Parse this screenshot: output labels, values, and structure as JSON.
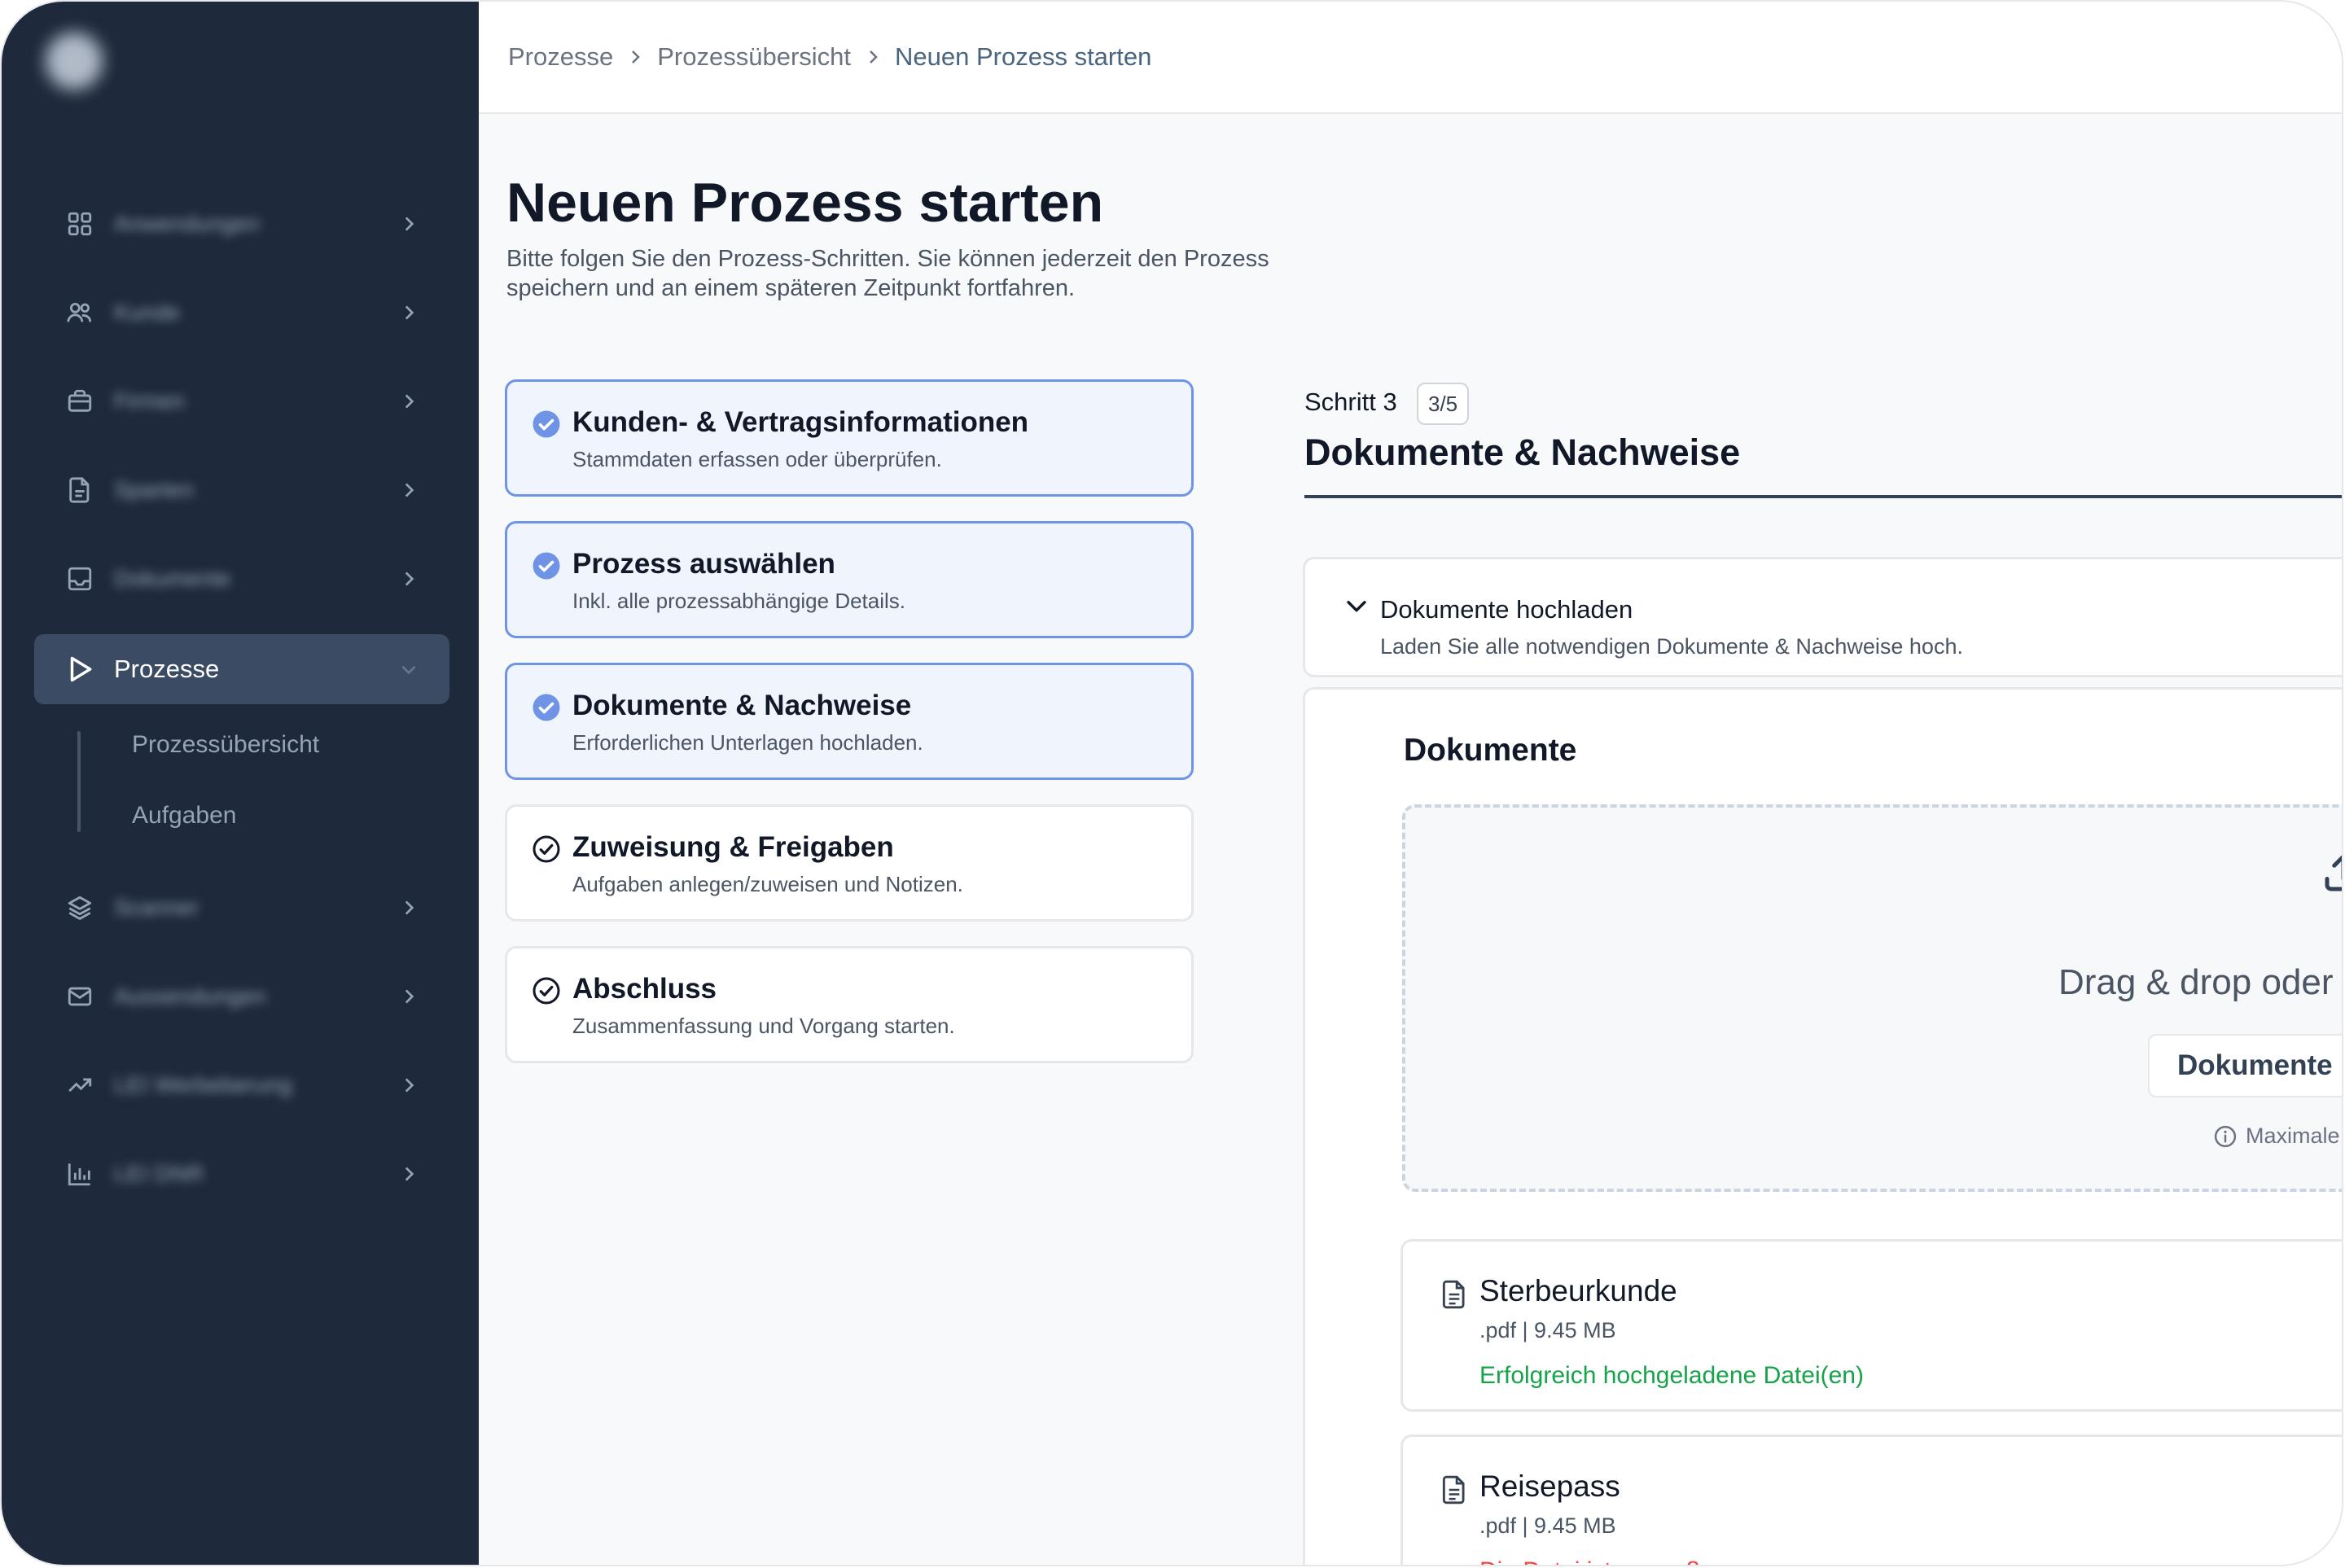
{
  "sidebar": {
    "items": [
      {
        "label": "Anwendungen",
        "icon": "grid-icon"
      },
      {
        "label": "Kunde",
        "icon": "users-icon"
      },
      {
        "label": "Firmen",
        "icon": "briefcase-icon"
      },
      {
        "label": "Sparten",
        "icon": "file-icon"
      },
      {
        "label": "Dokumente",
        "icon": "inbox-icon"
      },
      {
        "label": "Prozesse",
        "icon": "play-icon"
      },
      {
        "label": "Scanner",
        "icon": "layers-icon"
      },
      {
        "label": "Aussendungen",
        "icon": "mail-icon"
      },
      {
        "label": "LEI Werbeberung",
        "icon": "trending-up-icon"
      },
      {
        "label": "LEI DNR",
        "icon": "bar-chart-icon"
      }
    ],
    "sub_items": [
      "Prozessübersicht",
      "Aufgaben"
    ]
  },
  "breadcrumb": [
    "Prozesse",
    "Prozessübersicht",
    "Neuen Prozess starten"
  ],
  "page": {
    "title": "Neuen Prozess starten",
    "description": "Bitte folgen Sie den Prozess-Schritten. Sie können jederzeit den Prozess speichern und an einem späteren Zeitpunkt fortfahren."
  },
  "steps": [
    {
      "title": "Kunden- & Vertragsinformationen",
      "subtitle": "Stammdaten erfassen oder überprüfen.",
      "status": "done"
    },
    {
      "title": "Prozess auswählen",
      "subtitle": "Inkl. alle prozessabhängige Details.",
      "status": "done"
    },
    {
      "title": "Dokumente & Nachweise",
      "subtitle": "Erforderlichen Unterlagen hochladen.",
      "status": "done"
    },
    {
      "title": "Zuweisung & Freigaben",
      "subtitle": "Aufgaben anlegen/zuweisen und Notizen.",
      "status": "open"
    },
    {
      "title": "Abschluss",
      "subtitle": "Zusammenfassung und Vorgang starten.",
      "status": "open"
    }
  ],
  "current_step": {
    "label": "Schritt 3",
    "badge": "3/5",
    "title": "Dokumente & Nachweise"
  },
  "accordion": {
    "title": "Dokumente hochladen",
    "subtitle": "Laden Sie alle notwendigen Dokumente & Nachweise hoch."
  },
  "documents": {
    "title": "Dokumente",
    "drop_text": "Drag & drop oder",
    "button_label": "Dokumente",
    "max_info": "Maximale",
    "files": [
      {
        "name": "Sterbeurkunde",
        "meta": ".pdf | 9.45 MB",
        "status": "Erfolgreich hochgeladene Datei(en)",
        "status_type": "ok"
      },
      {
        "name": "Reisepass",
        "meta": ".pdf | 9.45 MB",
        "status": "Die Datei ist zu groß",
        "status_type": "err"
      }
    ]
  },
  "colors": {
    "sidebar_bg": "#1e293b",
    "active_nav": "#3b4b64",
    "step_done_border": "#6f94e6",
    "check_blue": "#6f94e6",
    "success": "#16a34a",
    "error": "#ef4444"
  }
}
